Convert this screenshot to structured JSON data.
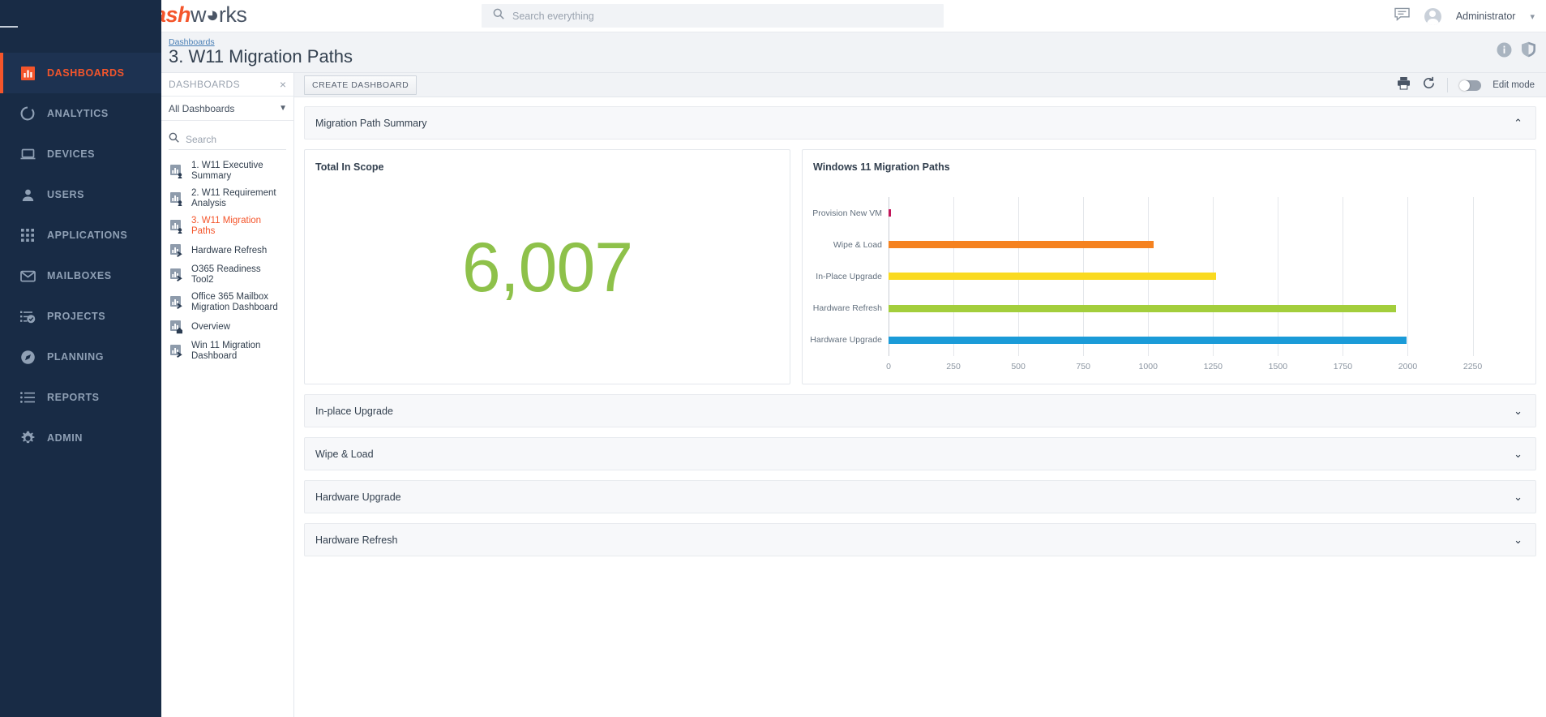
{
  "brand": {
    "part1": "dash",
    "part2": "w",
    "part3": "rks"
  },
  "topbar": {
    "search_placeholder": "Search everything",
    "user_name": "Administrator"
  },
  "leftnav": {
    "items": [
      {
        "label": "DASHBOARDS",
        "icon": "bar-chart-icon",
        "active": true
      },
      {
        "label": "ANALYTICS",
        "icon": "donut-icon",
        "active": false
      },
      {
        "label": "DEVICES",
        "icon": "laptop-icon",
        "active": false
      },
      {
        "label": "USERS",
        "icon": "user-icon",
        "active": false
      },
      {
        "label": "APPLICATIONS",
        "icon": "grid-icon",
        "active": false
      },
      {
        "label": "MAILBOXES",
        "icon": "envelope-icon",
        "active": false
      },
      {
        "label": "PROJECTS",
        "icon": "checklist-icon",
        "active": false
      },
      {
        "label": "PLANNING",
        "icon": "compass-icon",
        "active": false
      },
      {
        "label": "REPORTS",
        "icon": "list-icon",
        "active": false
      },
      {
        "label": "ADMIN",
        "icon": "gear-icon",
        "active": false
      }
    ]
  },
  "pagehead": {
    "breadcrumb": "Dashboards",
    "title": "3. W11 Migration Paths"
  },
  "dashpanel": {
    "header": "DASHBOARDS",
    "close": "×",
    "filter_value": "All Dashboards",
    "search_placeholder": "Search",
    "items": [
      {
        "label": "1. W11 Executive Summary",
        "selected": false,
        "badge": "user"
      },
      {
        "label": "2. W11 Requirement Analysis",
        "selected": false,
        "badge": "user"
      },
      {
        "label": "3. W11 Migration Paths",
        "selected": true,
        "badge": "user"
      },
      {
        "label": "Hardware Refresh",
        "selected": false,
        "badge": "shared"
      },
      {
        "label": "O365 Readiness Tool2",
        "selected": false,
        "badge": "shared"
      },
      {
        "label": "Office 365 Mailbox Migration Dashboard",
        "selected": false,
        "badge": "shared"
      },
      {
        "label": "Overview",
        "selected": false,
        "badge": "home"
      },
      {
        "label": "Win 11 Migration Dashboard",
        "selected": false,
        "badge": "shared"
      }
    ]
  },
  "toolbar": {
    "create_label": "CREATE DASHBOARD",
    "edit_mode_label": "Edit mode"
  },
  "sections": [
    {
      "title": "Migration Path Summary",
      "expanded": true,
      "chev": "⌃"
    },
    {
      "title": "In-place Upgrade",
      "expanded": false,
      "chev": "⌄"
    },
    {
      "title": "Wipe & Load",
      "expanded": false,
      "chev": "⌄"
    },
    {
      "title": "Hardware Upgrade",
      "expanded": false,
      "chev": "⌄"
    },
    {
      "title": "Hardware Refresh",
      "expanded": false,
      "chev": "⌄"
    }
  ],
  "total_in_scope": {
    "title": "Total In Scope",
    "value": "6,007",
    "color": "#8ec14a"
  },
  "chart_data": {
    "type": "bar",
    "orientation": "horizontal",
    "title": "Windows 11 Migration Paths",
    "xlabel": "",
    "ylabel": "",
    "categories": [
      "Provision New VM",
      "Wipe & Load",
      "In-Place Upgrade",
      "Hardware Refresh",
      "Hardware Upgrade"
    ],
    "values": [
      10,
      1020,
      1260,
      1955,
      1995
    ],
    "colors": [
      "#c2185b",
      "#f58220",
      "#fada20",
      "#a3ce3c",
      "#1b9bd8"
    ],
    "xlim": [
      0,
      2292
    ],
    "xticks": [
      0,
      250,
      500,
      750,
      1000,
      1250,
      1500,
      1750,
      2000,
      2250
    ],
    "xticklabels": [
      "0",
      "250",
      "500",
      "750",
      "1000",
      "1250",
      "1500",
      "1750",
      "2000",
      "2250"
    ],
    "grid": true,
    "legend": false
  }
}
